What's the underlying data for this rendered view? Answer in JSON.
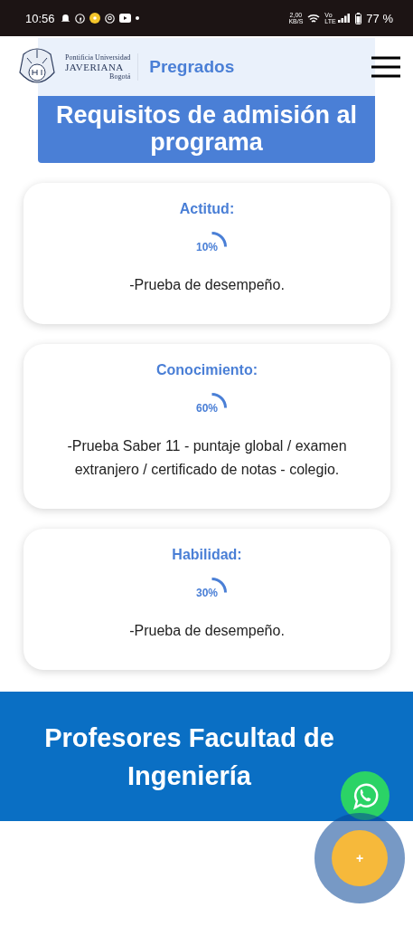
{
  "status_bar": {
    "time": "10:56",
    "speed": "2,00",
    "speed_unit": "KB/S",
    "network": "Vo LTE",
    "battery": "77 %"
  },
  "header": {
    "university_small": "Pontificia Universidad",
    "university": "JAVERIANA",
    "city": "Bogotá",
    "nav_title": "Pregrados"
  },
  "section_title": "Requisitos de admisión al programa",
  "requirements": [
    {
      "title": "Actitud:",
      "percent": "10%",
      "description": "-Prueba de desempeño."
    },
    {
      "title": "Conocimiento:",
      "percent": "60%",
      "description": "-Prueba Saber 11 - puntaje global / examen extranjero / certificado de notas - colegio."
    },
    {
      "title": "Habilidad:",
      "percent": "30%",
      "description": "-Prueba de desempeño."
    }
  ],
  "footer_title": "Profesores Facultad de Ingeniería",
  "fab": {
    "label": "+"
  }
}
